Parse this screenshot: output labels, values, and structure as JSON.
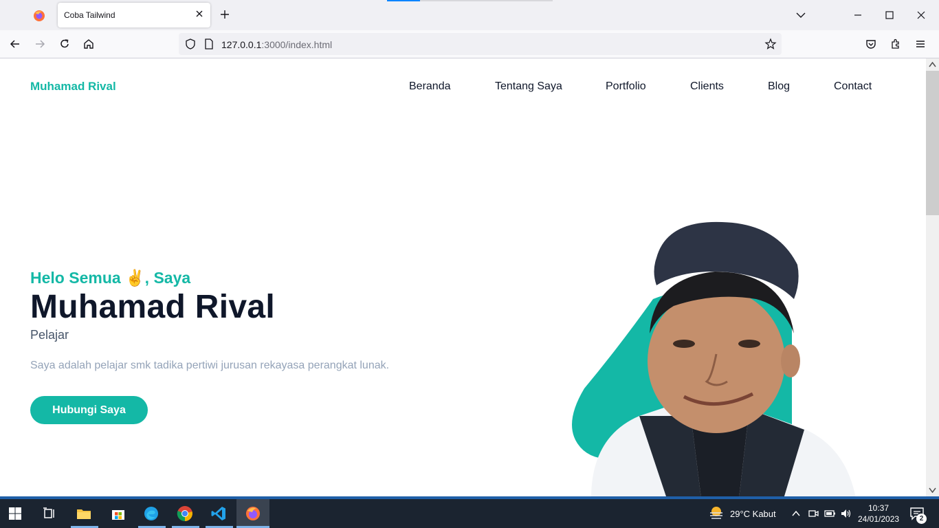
{
  "browser": {
    "tab_title": "Coba Tailwind",
    "url_host": "127.0.0.1",
    "url_rest": ":3000/index.html"
  },
  "site": {
    "brand": "Muhamad Rival",
    "menu": [
      "Beranda",
      "Tentang Saya",
      "Portfolio",
      "Clients",
      "Blog",
      "Contact"
    ],
    "hero": {
      "greeting": "Helo Semua ✌, Saya",
      "name": "Muhamad Rival",
      "role": "Pelajar",
      "description": "Saya adalah pelajar smk tadika pertiwi jurusan rekayasa perangkat lunak.",
      "cta": "Hubungi Saya"
    },
    "accent": "#14b8a6"
  },
  "taskbar": {
    "weather": "29°C  Kabut",
    "time": "10:37",
    "date": "24/01/2023",
    "notifications": "2"
  }
}
